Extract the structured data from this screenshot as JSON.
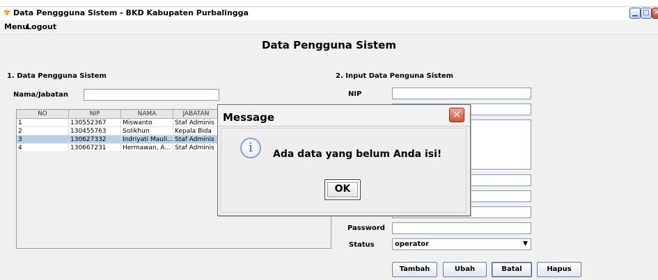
{
  "window": {
    "title": "Data Penggguna Sistem - BKD Kabupaten Purbalingga",
    "icon": "app-flower-icon",
    "controls": [
      "minimize",
      "maximize",
      "close"
    ]
  },
  "menubar": {
    "items": [
      "Menu",
      "Logout"
    ]
  },
  "page": {
    "title": "Data Pengguna Sistem"
  },
  "list_section": {
    "heading": "1. Data Pengguna Sistem",
    "filter_label": "Nama/Jabatan",
    "filter_value": "",
    "table": {
      "columns": [
        "NO",
        "NIP",
        "NAMA",
        "JABATAN"
      ],
      "rows": [
        [
          "1",
          "130552367",
          "Miswanto",
          "Staf Adminis"
        ],
        [
          "2",
          "130455763",
          "Solikhun",
          "Kepala Bida"
        ],
        [
          "3",
          "130627332",
          "Indriyati Mauli...",
          "Staf Adminis"
        ],
        [
          "4",
          "130667231",
          "Hermawan, A...",
          "Staf Adminis"
        ]
      ],
      "selected_row": 3
    }
  },
  "form_section": {
    "heading": "2. Input Data Penguna Sistem",
    "nip_label": "NIP",
    "nip_value": "",
    "password_label": "Password",
    "password_value": "",
    "status_label": "Status",
    "status_value": "operator",
    "buttons": {
      "tambah": "Tambah",
      "ubah": "Ubah",
      "batal": "Batal",
      "hapus": "Hapus"
    }
  },
  "dialog": {
    "title": "Message",
    "message": "Ada data yang belum Anda isi!",
    "ok_label": "OK",
    "icon": "info-icon"
  },
  "colors": {
    "selected_row": "#b8cfe5",
    "panel_bg": "#f0f0f0",
    "close_button": "#d2553a"
  }
}
